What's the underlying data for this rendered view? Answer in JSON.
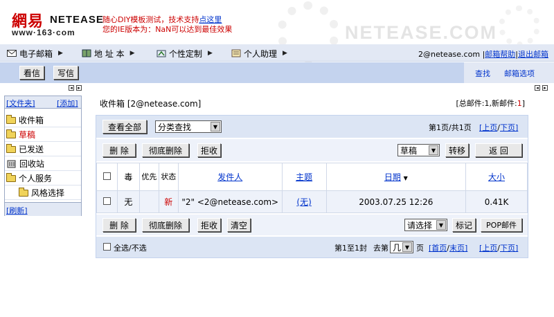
{
  "header": {
    "logo_cn": "網易",
    "logo_en": "NETEASE",
    "logo_url": "www·163·com",
    "notice_line1_prefix": "随心DIY模板测试，技术支持",
    "notice_line1_link": "点这里",
    "notice_line2": "您的IE版本为：NaN可以达到最佳效果",
    "watermark": "NETEASE.COM"
  },
  "nav": {
    "items": [
      {
        "label": "电子邮箱",
        "icon": "envelope-icon"
      },
      {
        "label": "地 址 本",
        "icon": "address-book-icon"
      },
      {
        "label": "个性定制",
        "icon": "customize-icon"
      },
      {
        "label": "个人助理",
        "icon": "assistant-icon"
      }
    ],
    "account": "2@netease.com",
    "help": "邮箱帮助",
    "logout": "退出邮箱"
  },
  "toolbar": {
    "read_label": "看信",
    "write_label": "写信",
    "search_label": "查找",
    "options_label": "邮箱选项"
  },
  "sidebar": {
    "folders_label": "[文件夹]",
    "add_label": "[添加]",
    "items": [
      {
        "label": "收件箱",
        "icon": "inbox-folder-icon"
      },
      {
        "label": "草稿",
        "icon": "draft-folder-icon"
      },
      {
        "label": "已发送",
        "icon": "sent-folder-icon"
      },
      {
        "label": "回收站",
        "icon": "trash-icon"
      },
      {
        "label": "个人服务",
        "icon": "folder-icon"
      },
      {
        "label": "风格选择",
        "icon": "folder-icon"
      }
    ],
    "refresh_label": "[刷新]"
  },
  "main": {
    "title": "收件箱 [2@netease.com]",
    "total_prefix": "[总邮件:1,新邮件:",
    "total_new": "1",
    "total_suffix": "]",
    "view_all": "查看全部",
    "category_select": "分类查找",
    "page_info": "第1页/共1页",
    "prev_page": "[上页",
    "next_page": "下页]",
    "delete": "删 除",
    "delete_perm": "彻底删除",
    "reject": "拒收",
    "move_target": "草稿",
    "move": "转移",
    "back": "返 回",
    "columns": {
      "poison": "毒",
      "priority": "优先",
      "status": "状态",
      "sender": "发件人",
      "subject": "主题",
      "date": "日期",
      "size": "大小"
    },
    "rows": [
      {
        "poison": "无",
        "status": "新",
        "sender": "\"2\" <2@netease.com>",
        "subject": "(无)",
        "date": "2003.07.25 12:26",
        "size": "0.41K"
      }
    ],
    "clear": "清空",
    "choose_select": "请选择",
    "mark": "标记",
    "pop": "POP邮件",
    "select_all": "全选/不选",
    "range_text": "第1至1封",
    "goto_prefix": "去第",
    "goto_select": "几",
    "goto_suffix": "页",
    "first_page": "[首页",
    "last_page": "末页]",
    "prev_page2": "[上页",
    "next_page2": "下页]"
  },
  "colors": {
    "accent_red": "#cc0000",
    "link_blue": "#0033cc",
    "nav_bg": "#e2e8f4",
    "toolbar_bg": "#c4d3ee",
    "bar_bg": "#dce5f4"
  }
}
